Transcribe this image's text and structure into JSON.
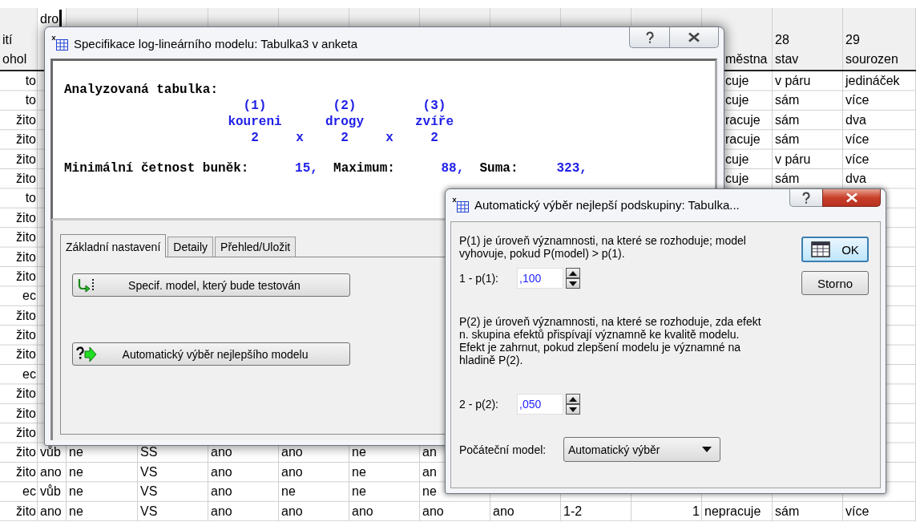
{
  "sheet": {
    "columns": [
      {
        "kind": "text",
        "editing": false,
        "header": [
          "ití",
          "ohol"
        ]
      },
      {
        "kind": "text",
        "editing": true,
        "header": [
          "dro"
        ]
      },
      {
        "kind": "text",
        "editing": false
      },
      {
        "kind": "text",
        "editing": false
      },
      {
        "kind": "text",
        "editing": false
      },
      {
        "kind": "text",
        "editing": false
      },
      {
        "kind": "text",
        "editing": false
      },
      {
        "kind": "text",
        "editing": false
      },
      {
        "kind": "text",
        "editing": false
      },
      {
        "kind": "text",
        "editing": false
      },
      {
        "kind": "number",
        "editing": false
      },
      {
        "kind": "text",
        "editing": false,
        "header": [
          "městna"
        ]
      },
      {
        "kind": "text",
        "editing": false,
        "header": [
          "28",
          "stav"
        ]
      },
      {
        "kind": "text",
        "editing": false,
        "header": [
          "29",
          "sourozen"
        ]
      }
    ],
    "rows": [
      [
        "to",
        null,
        null,
        null,
        null,
        null,
        null,
        null,
        null,
        null,
        null,
        "cuje",
        "v páru",
        "jedináček"
      ],
      [
        "to",
        null,
        null,
        null,
        null,
        null,
        null,
        null,
        null,
        null,
        null,
        "cuje",
        "sám",
        "více"
      ],
      [
        "žito",
        null,
        null,
        null,
        null,
        null,
        null,
        null,
        null,
        null,
        null,
        "racuje",
        "sám",
        "dva"
      ],
      [
        "žito",
        null,
        null,
        null,
        null,
        null,
        null,
        null,
        null,
        null,
        null,
        "racuje",
        "sám",
        "více"
      ],
      [
        "žito",
        null,
        null,
        null,
        null,
        null,
        null,
        null,
        null,
        null,
        null,
        "cuje",
        "v páru",
        "více"
      ],
      [
        "žito",
        null,
        null,
        null,
        null,
        null,
        null,
        null,
        null,
        null,
        null,
        "cuje",
        "sám",
        "dva"
      ],
      [
        "to",
        null,
        null,
        null,
        null,
        null,
        null,
        null,
        null,
        null,
        null,
        null,
        null,
        null
      ],
      [
        "žito",
        null,
        null,
        null,
        null,
        null,
        null,
        null,
        null,
        null,
        null,
        null,
        null,
        null
      ],
      [
        "žito",
        null,
        null,
        null,
        null,
        null,
        null,
        null,
        null,
        null,
        null,
        null,
        null,
        null
      ],
      [
        "žito",
        null,
        null,
        null,
        null,
        null,
        null,
        null,
        null,
        null,
        null,
        null,
        null,
        null
      ],
      [
        "žito",
        null,
        null,
        null,
        null,
        null,
        null,
        null,
        null,
        null,
        null,
        null,
        null,
        null
      ],
      [
        "ec",
        null,
        null,
        null,
        null,
        null,
        null,
        null,
        null,
        null,
        null,
        null,
        null,
        null
      ],
      [
        "žito",
        null,
        null,
        null,
        null,
        null,
        null,
        null,
        null,
        null,
        null,
        null,
        null,
        null
      ],
      [
        "žito",
        null,
        null,
        null,
        null,
        null,
        null,
        null,
        null,
        null,
        null,
        null,
        null,
        null
      ],
      [
        "žito",
        null,
        null,
        null,
        null,
        null,
        null,
        null,
        null,
        null,
        null,
        null,
        null,
        null
      ],
      [
        "ec",
        null,
        null,
        null,
        null,
        null,
        null,
        null,
        null,
        null,
        null,
        null,
        null,
        null
      ],
      [
        "žito",
        null,
        null,
        null,
        null,
        null,
        null,
        null,
        null,
        null,
        null,
        null,
        null,
        null
      ],
      [
        "žito",
        null,
        null,
        null,
        null,
        null,
        null,
        null,
        null,
        null,
        null,
        null,
        null,
        null
      ],
      [
        "žito",
        null,
        null,
        null,
        null,
        null,
        null,
        null,
        null,
        null,
        null,
        null,
        null,
        null
      ],
      [
        "žito",
        "vůb",
        "ne",
        "SS",
        "ano",
        "ano",
        "ne",
        "an",
        null,
        null,
        null,
        null,
        null,
        null
      ],
      [
        "žito",
        "ano",
        "ne",
        "VS",
        "ano",
        "ano",
        "ne",
        "an",
        null,
        null,
        null,
        null,
        null,
        null
      ],
      [
        "ec",
        "vůb",
        "ne",
        "VS",
        "ano",
        "ne",
        "ne",
        "ne",
        null,
        null,
        null,
        null,
        null,
        null
      ],
      [
        "žito",
        "ano",
        "ne",
        "VS",
        "ano",
        "ano",
        "ano",
        "ano",
        "ano",
        "1-2",
        "1",
        "nepracuje",
        "sám",
        "více"
      ]
    ]
  },
  "main_dialog": {
    "title": "Specifikace log-lineárního modelu: Tabulka3 v anketa",
    "active": false,
    "output": {
      "heading": "Analyzovaná tabulka:",
      "factors": [
        {
          "index": "(1)",
          "name": "koureni",
          "levels": "2"
        },
        {
          "index": "(2)",
          "name": "drogy",
          "levels": "2"
        },
        {
          "index": "(3)",
          "name": "zvíře",
          "levels": "2"
        }
      ],
      "operators": [
        "x",
        "x"
      ],
      "stats": [
        {
          "label": "Minimální četnost buněk:",
          "value": "15,"
        },
        {
          "label": "Maximum:",
          "value": "88,"
        },
        {
          "label": "Suma:",
          "value": "323,"
        }
      ]
    },
    "tabs": [
      {
        "label": "Základní nastavení",
        "selected": true
      },
      {
        "label": "Detaily",
        "selected": false
      },
      {
        "label": "Přehled/Uložit",
        "selected": false
      }
    ],
    "buttons": [
      {
        "label": "Specif. model, který bude testován"
      },
      {
        "label": "Automatický výběr nejlepšího modelu"
      }
    ]
  },
  "auto_dialog": {
    "title": "Automatický výběr nejlepší podskupiny: Tabulka...",
    "active": true,
    "items": [
      {
        "kind": "text",
        "text": "P(1) je úroveň významnosti, na které se rozhoduje; model vyhovuje, pokud P(model) > p(1)."
      },
      {
        "kind": "spin",
        "label": "1 - p(1):",
        "value": ",100"
      },
      {
        "kind": "text",
        "text": "P(2) je úroveň významnosti, na které se rozhoduje, zda efekt n. skupina efektů přispívají významně ke kvalitě modelu. Efekt je zahrnut, pokud zlepšení modelu je významné na hladině P(2)."
      },
      {
        "kind": "spin",
        "label": "2 - p(2):",
        "value": ",050"
      },
      {
        "kind": "select",
        "label": "Počáteční model:",
        "value": "Automatický výběr"
      }
    ],
    "buttons": [
      {
        "label": "OK",
        "default": true
      },
      {
        "label": "Storno",
        "default": false
      }
    ]
  }
}
